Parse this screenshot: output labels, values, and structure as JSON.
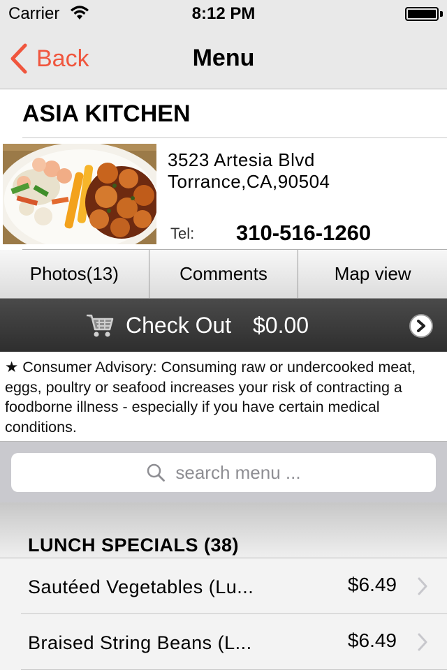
{
  "status_bar": {
    "carrier": "Carrier",
    "time": "8:12 PM",
    "battery_level": 1.0
  },
  "nav": {
    "back_label": "Back",
    "title": "Menu",
    "accent_color": "#f0563e"
  },
  "restaurant": {
    "name": "ASIA KITCHEN",
    "address_line1": "3523 Artesia Blvd",
    "address_line2": "Torrance,CA,90504",
    "tel_label": "Tel:",
    "tel_number": "310-516-1260",
    "photo_icon": "food-dish-photo"
  },
  "tabs": [
    {
      "label": "Photos(13)"
    },
    {
      "label": "Comments"
    },
    {
      "label": "Map view"
    }
  ],
  "checkout": {
    "label": "Check Out",
    "total": "$0.00",
    "cart_icon": "shopping-cart-icon",
    "arrow_icon": "chevron-right-circle-icon"
  },
  "advisory": {
    "text": "★ Consumer Advisory: Consuming raw or undercooked meat, eggs, poultry or seafood increases your risk of contracting a foodborne illness - especially if you have certain medical conditions."
  },
  "search": {
    "placeholder": "search menu ...",
    "icon": "search-icon"
  },
  "menu": {
    "section_title": "LUNCH SPECIALS (38)",
    "items": [
      {
        "name": "Sautéed Vegetables (Lu...",
        "price": "$6.49"
      },
      {
        "name": "Braised String Beans (L...",
        "price": "$6.49"
      }
    ]
  }
}
